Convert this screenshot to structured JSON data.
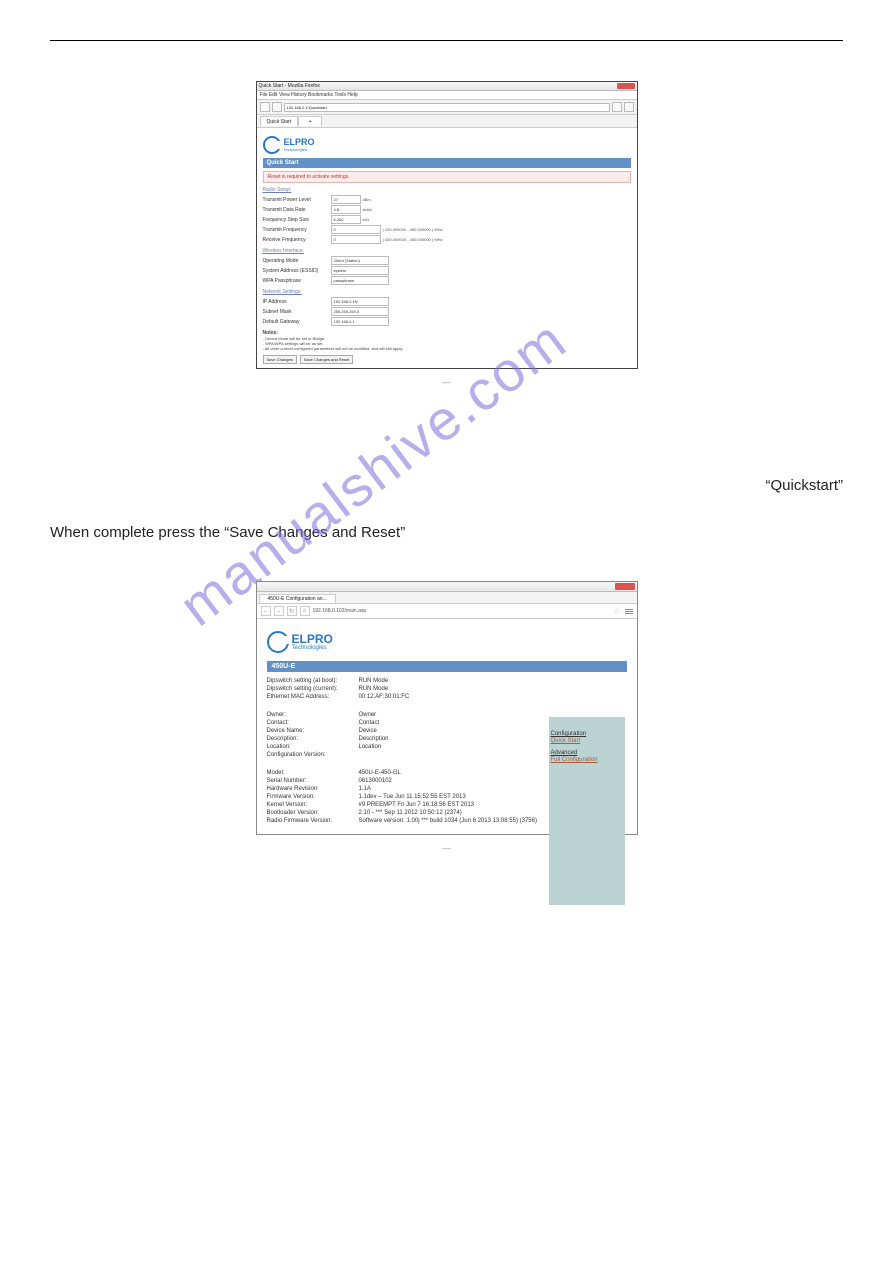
{
  "watermark": "manualshive.com",
  "doc": {
    "quickstart_line": "“Quickstart”",
    "complete_line": "When complete press the “Save Changes and Reset”"
  },
  "fig_dash": "—",
  "shot1": {
    "window_title": "Quick Start - Mozilla Firefox",
    "menu": "File  Edit  View  History  Bookmarks  Tools  Help",
    "address": "192.168.0.1/Quickstart",
    "tab": "Quick Start",
    "logo_main": "ELPRO",
    "logo_sub": "Technologies",
    "page_bar": "Quick Start",
    "alert": "Reset is required to activate settings.",
    "sections": {
      "radio": "Radio Setup:",
      "wireless": "Wireless Interface:",
      "network": "Network Settings:"
    },
    "radio": {
      "tx_power_l": "Transmit Power Level",
      "tx_power_v": "27",
      "tx_power_u": "dBm",
      "data_rate_l": "Transmit Data Rate",
      "data_rate_v": "4.8",
      "data_rate_u": "kbit/s",
      "step_l": "Frequency Step Size",
      "step_v": "6.250",
      "step_u": "kHz",
      "txfreq_l": "Transmit Frequency",
      "txfreq_v": "0",
      "txfreq_u": "( 430.000000 - 450.000000 ) MHz",
      "rxfreq_l": "Receive Frequency",
      "rxfreq_v": "0",
      "rxfreq_u": "( 430.000000 - 450.000000 ) MHz"
    },
    "wireless": {
      "mode_l": "Operating Mode",
      "mode_v": "Client (Station)",
      "essid_l": "System Address (ESSID)",
      "essid_v": "system",
      "wpa_l": "WPA Passphrase",
      "wpa_v": "passphrase"
    },
    "network": {
      "ip_l": "IP Address",
      "ip_v": "192.168.0.1N",
      "mask_l": "Subnet Mask",
      "mask_v": "255.255.255.0",
      "gw_l": "Default Gateway",
      "gw_v": "192.168.0.1"
    },
    "notes_title": "Notes:",
    "notes1": "- Device Mode will be set to Bridge.",
    "notes2": "- WPA/WPA settings will be as set.",
    "notes3": "- All other current configured parameters will not be modified, and will still apply.",
    "btn_save": "Save Changes",
    "btn_reset": "Save Changes and Reset"
  },
  "shot2": {
    "tab": "450U-E Configuration an...",
    "url": "192.168.0.102/main.asp",
    "logo_main": "ELPRO",
    "logo_sub": "Technologies",
    "bar": "450U-E",
    "rows1": [
      {
        "k": "Dipswitch setting (at boot):",
        "v": "RUN Mode"
      },
      {
        "k": "Dipswitch setting (current):",
        "v": "RUN Mode"
      },
      {
        "k": "Ethernet MAC Address:",
        "v": "00:12:AF:30:01:FC"
      }
    ],
    "rows2": [
      {
        "k": "Owner:",
        "v": "Owner"
      },
      {
        "k": "Contact:",
        "v": "Contact"
      },
      {
        "k": "Device Name:",
        "v": "Device"
      },
      {
        "k": "Description:",
        "v": "Description"
      },
      {
        "k": "Location:",
        "v": "Location"
      },
      {
        "k": "Configuration Version:",
        "v": ""
      }
    ],
    "rows3": [
      {
        "k": "Model:",
        "v": "450U-E-450-GL"
      },
      {
        "k": "Serial Number:",
        "v": "0613000102"
      },
      {
        "k": "Hardware Revision:",
        "v": "1.1A"
      },
      {
        "k": "Firmware Version:",
        "v": "1.1dev – Tue Jun 11 15:52:55 EST 2013"
      },
      {
        "k": "Kernel Version:",
        "v": "#9 PREEMPT Fri Jun 7 16:18:56 EST 2013"
      },
      {
        "k": "Bootloader Version:",
        "v": "2.10 - *** Sep 11 2012 10:50:12 (2374)"
      },
      {
        "k": "Radio Firmware Version:",
        "v": "Software version: 1.00j *** build 1034 (Jun 6 2013 13:08:55) (3756)"
      }
    ],
    "right": {
      "cfg": "Configuration",
      "qs": "Quick Start",
      "adv": "Advanced",
      "full": "Full Configuration"
    }
  }
}
